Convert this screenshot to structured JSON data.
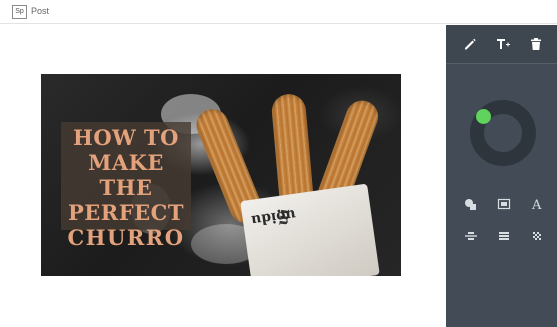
{
  "app": {
    "logo_text": "Sp",
    "title": "Post"
  },
  "design": {
    "headline_lines": [
      "HOW TO",
      "MAKE THE",
      "PERFECT",
      "CHURRO"
    ],
    "paper_text": "ui",
    "paper_text_2": "uoidu"
  },
  "toolbar": {
    "tools": [
      "edit-icon",
      "add-text-icon",
      "trash-icon"
    ]
  },
  "panel": {
    "options_row1": [
      "shapes-icon",
      "image-icon",
      "text-style-icon"
    ],
    "options_row2": [
      "align-icon",
      "layout-icon",
      "texture-icon"
    ]
  },
  "colors": {
    "accent": "#5fd35b",
    "panel_bg": "#3e4750",
    "headline": "#e3a27b"
  }
}
